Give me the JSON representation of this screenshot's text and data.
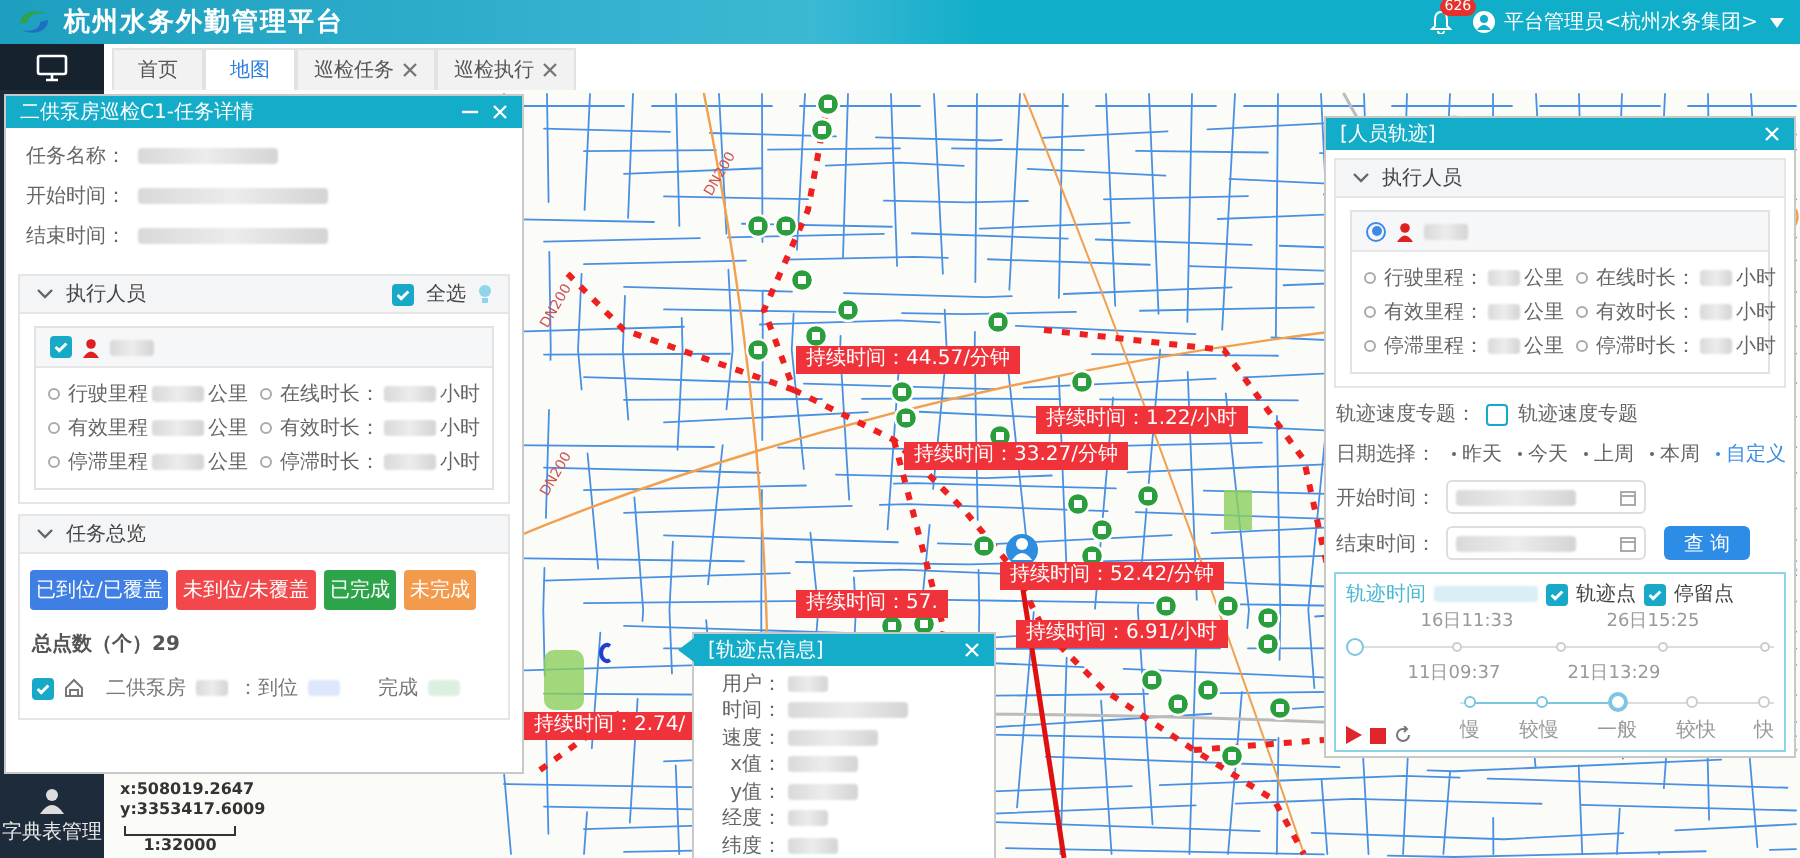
{
  "header": {
    "title": "杭州水务外勤管理平台",
    "notification_count": "626",
    "user": "平台管理员<杭州水务集团>"
  },
  "sidebar": {
    "items": [
      {
        "label": "字典表管理"
      }
    ]
  },
  "tabs": [
    {
      "label": "首页",
      "selected": false,
      "closable": false
    },
    {
      "label": "地图",
      "selected": true,
      "closable": false
    },
    {
      "label": "巡检任务",
      "selected": false,
      "closable": true
    },
    {
      "label": "巡检执行",
      "selected": false,
      "closable": true
    }
  ],
  "map": {
    "pipe_labels": [
      "DN200",
      "DN200",
      "DN200"
    ],
    "duration_labels": [
      "持续时间：44.57/分钟",
      "持续时间：1.22/小时",
      "持续时间：33.27/分钟",
      "持续时间：52.42/分钟",
      "持续时间：57.",
      "持续时间：6.91/小时",
      "持续时间：2.74/"
    ],
    "coordinates": {
      "x": "x:508019.2647",
      "y": "y:3353417.6009"
    },
    "scale": "1:32000"
  },
  "task_panel": {
    "title": "二供泵房巡检C1-任务详情",
    "fields": [
      "任务名称：",
      "开始时间：",
      "结束时间："
    ],
    "personnel": {
      "title": "执行人员",
      "select_all": {
        "label": "全选",
        "checked": true
      },
      "person_checked": true,
      "stats": [
        {
          "label": "行驶里程",
          "unit": "公里"
        },
        {
          "label": "在线时长：",
          "unit": "小时"
        },
        {
          "label": "有效里程",
          "unit": "公里"
        },
        {
          "label": "有效时长：",
          "unit": "小时"
        },
        {
          "label": "停滞里程",
          "unit": "公里"
        },
        {
          "label": "停滞时长：",
          "unit": "小时"
        }
      ]
    },
    "overview": {
      "title": "任务总览",
      "legend": [
        {
          "label": "已到位/已覆盖",
          "color": "#3f7fe3"
        },
        {
          "label": "未到位/未覆盖",
          "color": "#f2484b"
        },
        {
          "label": "已完成",
          "color": "#2ea44a"
        },
        {
          "label": "未完成",
          "color": "#f39a4d"
        }
      ],
      "total": "总点数（个）29",
      "points": [
        {
          "name": "二供泵房",
          "checked": true,
          "arrived_label": "：到位",
          "done_label": "完成"
        }
      ]
    }
  },
  "track_panel": {
    "title": "[人员轨迹]",
    "personnel_title": "执行人员",
    "person_selected": true,
    "stats": [
      {
        "label": "行驶里程：",
        "unit": "公里"
      },
      {
        "label": "在线时长：",
        "unit": "小时"
      },
      {
        "label": "有效里程：",
        "unit": "公里"
      },
      {
        "label": "有效时长：",
        "unit": "小时"
      },
      {
        "label": "停滞里程：",
        "unit": "公里"
      },
      {
        "label": "停滞时长：",
        "unit": "小时"
      }
    ],
    "speed_topic": {
      "label": "轨迹速度专题：",
      "option": "轨迹速度专题",
      "checked": false
    },
    "date_label": "日期选择：",
    "date_options": [
      {
        "label": "昨天",
        "selected": false
      },
      {
        "label": "今天",
        "selected": false
      },
      {
        "label": "上周",
        "selected": false
      },
      {
        "label": "本周",
        "selected": false
      },
      {
        "label": "自定义",
        "selected": true
      }
    ],
    "start_label": "开始时间：",
    "end_label": "结束时间：",
    "query_button": "查 询",
    "timeline": {
      "label": "轨迹时间",
      "toggles": [
        {
          "label": "轨迹点",
          "checked": true
        },
        {
          "label": "停留点",
          "checked": true
        }
      ],
      "ticks_top": [
        "16日11:33",
        "26日15:25"
      ],
      "ticks_bottom": [
        "11日09:37",
        "21日13:29"
      ],
      "level": 0
    },
    "speeds": [
      {
        "label": "慢",
        "selected": false
      },
      {
        "label": "较慢",
        "selected": false
      },
      {
        "label": "一般",
        "selected": true
      },
      {
        "label": "较快",
        "selected": false
      },
      {
        "label": "快",
        "selected": false
      }
    ]
  },
  "point_popup": {
    "title": "[轨迹点信息]",
    "fields": [
      "用户：",
      "时间：",
      "速度：",
      "x值：",
      "y值：",
      "经度：",
      "纬度："
    ]
  }
}
